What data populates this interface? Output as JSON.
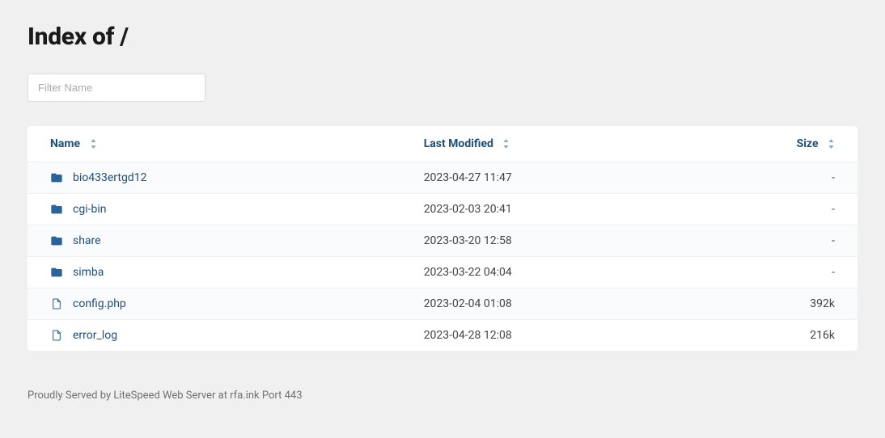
{
  "title": "Index of /",
  "filter": {
    "placeholder": "Filter Name"
  },
  "columns": {
    "name": "Name",
    "modified": "Last Modified",
    "size": "Size"
  },
  "entries": [
    {
      "type": "folder",
      "name": "bio433ertgd12",
      "modified": "2023-04-27 11:47",
      "size": "-"
    },
    {
      "type": "folder",
      "name": "cgi-bin",
      "modified": "2023-02-03 20:41",
      "size": "-"
    },
    {
      "type": "folder",
      "name": "share",
      "modified": "2023-03-20 12:58",
      "size": "-"
    },
    {
      "type": "folder",
      "name": "simba",
      "modified": "2023-03-22 04:04",
      "size": "-"
    },
    {
      "type": "file",
      "name": "config.php",
      "modified": "2023-02-04 01:08",
      "size": "392k"
    },
    {
      "type": "file",
      "name": "error_log",
      "modified": "2023-04-28 12:08",
      "size": "216k"
    }
  ],
  "footer": "Proudly Served by LiteSpeed Web Server at rfa.ink Port 443",
  "colors": {
    "link": "#1e4f7c",
    "folder_icon": "#2a629a",
    "file_icon": "#2a629a"
  }
}
